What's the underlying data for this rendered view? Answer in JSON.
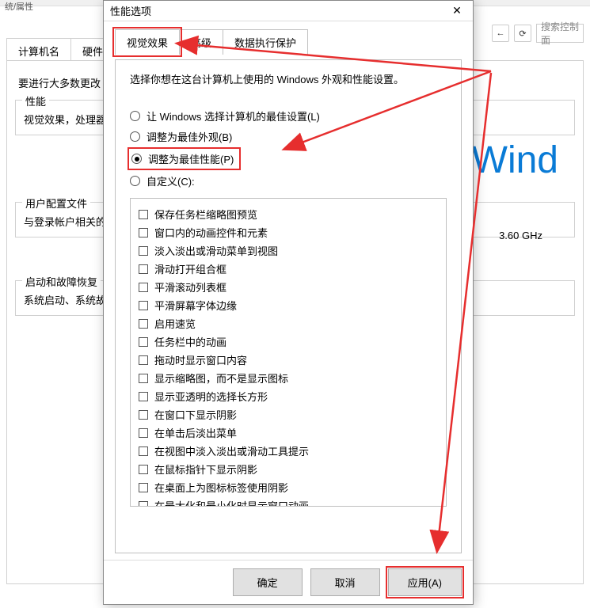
{
  "bg": {
    "titlebar": "统/属性",
    "back_icon": "←",
    "refresh_icon": "⟳",
    "search_placeholder": "搜索控制面",
    "tabs": [
      "计算机名",
      "硬件"
    ],
    "intro": "要进行大多数更改",
    "group1_title": "性能",
    "group1_text": "视觉效果，处理器",
    "group2_title": "用户配置文件",
    "group2_text": "与登录帐户相关的",
    "group3_title": "启动和故障恢复",
    "group3_text": "系统启动、系统故",
    "wind": "Wind",
    "cpu": "3.60 GHz"
  },
  "dialog": {
    "title": "性能选项",
    "close": "✕",
    "tabs": {
      "visual": "视觉效果",
      "advanced": "高级",
      "dep": "数据执行保护"
    },
    "desc": "选择你想在这台计算机上使用的 Windows 外观和性能设置。",
    "radios": {
      "auto": "让 Windows 选择计算机的最佳设置(L)",
      "best_appearance": "调整为最佳外观(B)",
      "best_performance": "调整为最佳性能(P)",
      "custom": "自定义(C):"
    },
    "checks": [
      "保存任务栏缩略图预览",
      "窗口内的动画控件和元素",
      "淡入淡出或滑动菜单到视图",
      "滑动打开组合框",
      "平滑滚动列表框",
      "平滑屏幕字体边缘",
      "启用速览",
      "任务栏中的动画",
      "拖动时显示窗口内容",
      "显示缩略图，而不是显示图标",
      "显示亚透明的选择长方形",
      "在窗口下显示阴影",
      "在单击后淡出菜单",
      "在视图中淡入淡出或滑动工具提示",
      "在鼠标指针下显示阴影",
      "在桌面上为图标标签使用阴影",
      "在最大化和最小化时显示窗口动画"
    ],
    "buttons": {
      "ok": "确定",
      "cancel": "取消",
      "apply": "应用(A)"
    }
  }
}
